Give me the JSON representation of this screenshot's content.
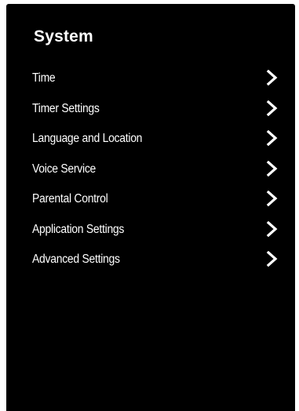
{
  "header": {
    "title": "System"
  },
  "menu": {
    "items": [
      {
        "label": "Time",
        "icon": "chevron-right-icon"
      },
      {
        "label": "Timer Settings",
        "icon": "chevron-right-icon"
      },
      {
        "label": "Language and Location",
        "icon": "chevron-right-icon"
      },
      {
        "label": "Voice Service",
        "icon": "chevron-right-icon"
      },
      {
        "label": "Parental Control",
        "icon": "chevron-right-icon"
      },
      {
        "label": "Application Settings",
        "icon": "chevron-right-icon"
      },
      {
        "label": "Advanced Settings",
        "icon": "chevron-right-icon"
      }
    ]
  },
  "colors": {
    "panel_background": "#000000",
    "text": "#ffffff",
    "page_background": "#ffffff"
  }
}
